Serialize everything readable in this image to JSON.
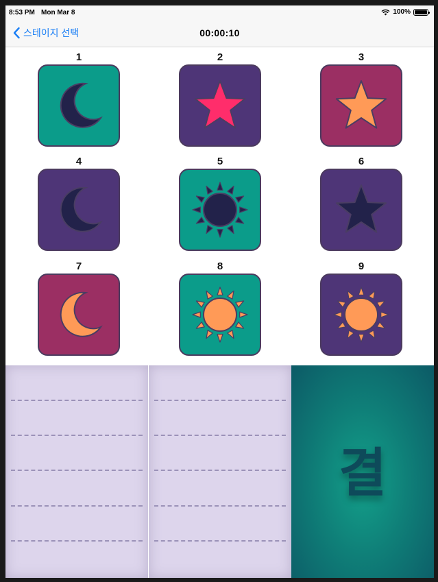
{
  "status_bar": {
    "time": "8:53 PM",
    "date": "Mon Mar 8",
    "battery_text": "100%",
    "battery_level": 1.0
  },
  "nav": {
    "back_label": "스테이지 선택",
    "title": "00:00:10"
  },
  "colors": {
    "teal": "#0b9c8a",
    "purple": "#4e3577",
    "magenta": "#9b2f63",
    "navy": "#22224a",
    "pink": "#ff2d6b",
    "orange": "#ff9a57",
    "back_blue": "#1b7ff5",
    "result_text": "#0e4a5a"
  },
  "tiles": [
    {
      "number": "1",
      "bg": "teal",
      "shape": "moon",
      "color": "navy"
    },
    {
      "number": "2",
      "bg": "purple",
      "shape": "star",
      "color": "pink"
    },
    {
      "number": "3",
      "bg": "magenta",
      "shape": "star",
      "color": "orange"
    },
    {
      "number": "4",
      "bg": "purple",
      "shape": "moon",
      "color": "navy"
    },
    {
      "number": "5",
      "bg": "teal",
      "shape": "sun",
      "color": "navy"
    },
    {
      "number": "6",
      "bg": "purple",
      "shape": "star",
      "color": "navy"
    },
    {
      "number": "7",
      "bg": "magenta",
      "shape": "moon",
      "color": "orange"
    },
    {
      "number": "8",
      "bg": "teal",
      "shape": "sun",
      "color": "orange"
    },
    {
      "number": "9",
      "bg": "purple",
      "shape": "sun",
      "color": "orange"
    }
  ],
  "result_card": {
    "text": "결"
  }
}
